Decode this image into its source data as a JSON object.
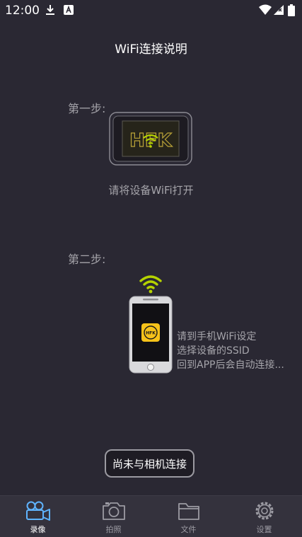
{
  "statusbar": {
    "time": "12:00"
  },
  "page": {
    "title": "WiFi连接说明"
  },
  "steps": {
    "step1_label": "第一步:",
    "step1_text": "请将设备WiFi打开",
    "step2_label": "第二步:",
    "step2_lines": [
      "请到手机WiFi设定",
      "选择设备的SSID",
      "回到APP后会自动连接..."
    ],
    "device_logo": "HFK"
  },
  "connect_button": {
    "label": "尚未与相机连接"
  },
  "tabs": [
    {
      "label": "录像",
      "icon": "video-camera-icon",
      "active": true
    },
    {
      "label": "拍照",
      "icon": "camera-icon",
      "active": false
    },
    {
      "label": "文件",
      "icon": "folder-icon",
      "active": false
    },
    {
      "label": "设置",
      "icon": "gear-icon",
      "active": false
    }
  ],
  "colors": {
    "accent": "#5fb4ff",
    "wifi_green": "#b5d300",
    "logo_yellow": "#f6c21a",
    "background": "#2a2833"
  }
}
